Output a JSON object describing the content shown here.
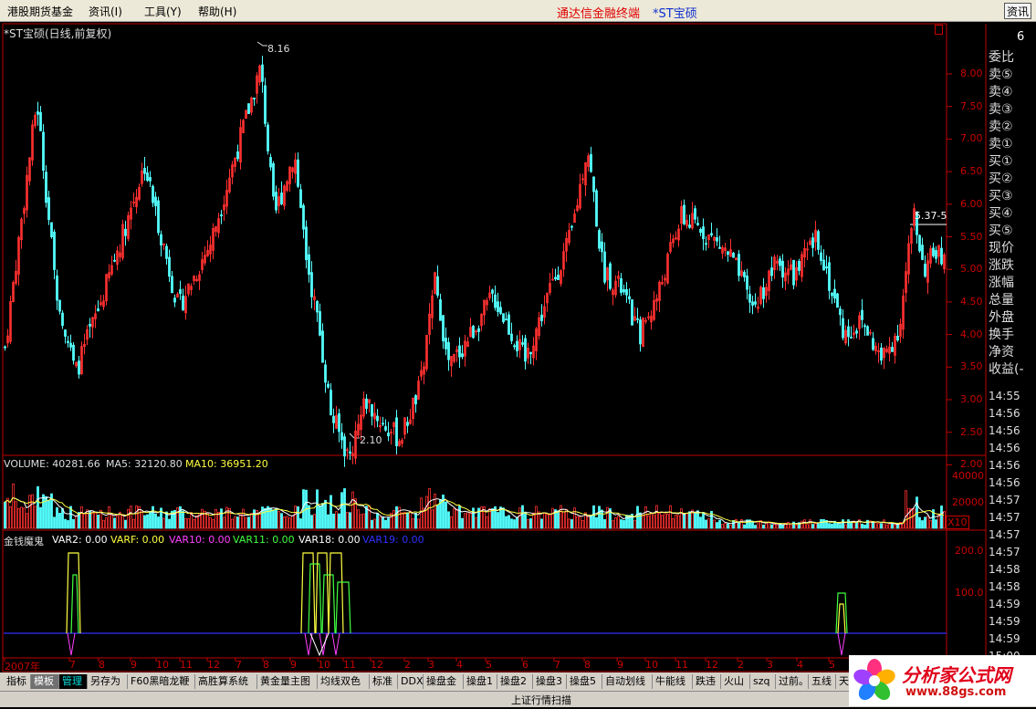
{
  "menu": {
    "items": [
      "港股期货基金",
      "资讯(I)",
      "工具(Y)",
      "帮助(H)"
    ],
    "app_title": "通达信金融终端",
    "stock_title": "*ST宝硕",
    "info_button": "资讯"
  },
  "chart": {
    "title": "*ST宝硕(日线,前复权)",
    "high_label": "8.16",
    "low_label": "2.10",
    "current_label": "5.37-5",
    "price_axis": [
      "8.00",
      "7.50",
      "7.00",
      "6.50",
      "6.00",
      "5.50",
      "5.00",
      "4.50",
      "4.00",
      "3.50",
      "3.00",
      "2.50",
      "2.00"
    ]
  },
  "volume": {
    "title": "VOLUME: 40281.66",
    "ma5": "MA5: 32120.80",
    "ma10": "MA10: 36951.20",
    "axis": [
      "40000",
      "20000"
    ],
    "unit": "X10"
  },
  "indicator": {
    "name": "金钱魔鬼",
    "vars": [
      {
        "text": "VAR2: 0.00",
        "color": "#ffffff"
      },
      {
        "text": "VARF: 0.00",
        "color": "#ffff40"
      },
      {
        "text": "VAR10: 0.00",
        "color": "#ff40ff"
      },
      {
        "text": "VAR11: 0.00",
        "color": "#40ff40"
      },
      {
        "text": "VAR18: 0.00",
        "color": "#ffffff"
      },
      {
        "text": "VAR19: 0.00",
        "color": "#3030ff"
      }
    ],
    "axis": [
      "200.0",
      "100.0"
    ]
  },
  "date_axis": [
    "2007年",
    "7",
    "8",
    "9",
    "10",
    "11",
    "12",
    "7",
    "8",
    "9",
    "10",
    "11",
    "12",
    "2",
    "3",
    "4",
    "5",
    "6",
    "7",
    "8",
    "9",
    "10",
    "11",
    "12",
    "2",
    "3",
    "4",
    "5",
    "6"
  ],
  "quote_panel": {
    "rows": [
      "委比",
      "卖⑤",
      "卖④",
      "卖③",
      "卖②",
      "卖①",
      "买①",
      "买②",
      "买③",
      "买④",
      "买⑤",
      "现价",
      "涨跌",
      "涨幅",
      "总量",
      "外盘",
      "换手",
      "净资",
      "收益(-"
    ],
    "corner": "6",
    "times": [
      "14:55",
      "14:56",
      "14:56",
      "14:56",
      "14:56",
      "14:56",
      "14:57",
      "14:57",
      "14:57",
      "14:57",
      "14:58",
      "14:58",
      "14:59",
      "14:59",
      "14:59",
      "15:00"
    ]
  },
  "tabs": [
    "指标",
    "模板",
    "管理",
    "另存为",
    "F60黑暗龙鞭",
    "高胜算系统",
    "黄金量主图",
    "均线双色",
    "标准",
    "DDX",
    "操盘金",
    "操盘1",
    "操盘2",
    "操盘3",
    "操盘5",
    "自动划线",
    "牛能线",
    "跌违",
    "火山",
    "szq",
    "过前。",
    "五线",
    "天"
  ],
  "status": {
    "text": "上证行情扫描"
  },
  "logo": {
    "name": "分析家公式网",
    "url": "www.88gs.com"
  },
  "colors": {
    "up": "#ff3030",
    "down": "#54ffff",
    "axis": "#c00000",
    "bg": "#000000"
  }
}
